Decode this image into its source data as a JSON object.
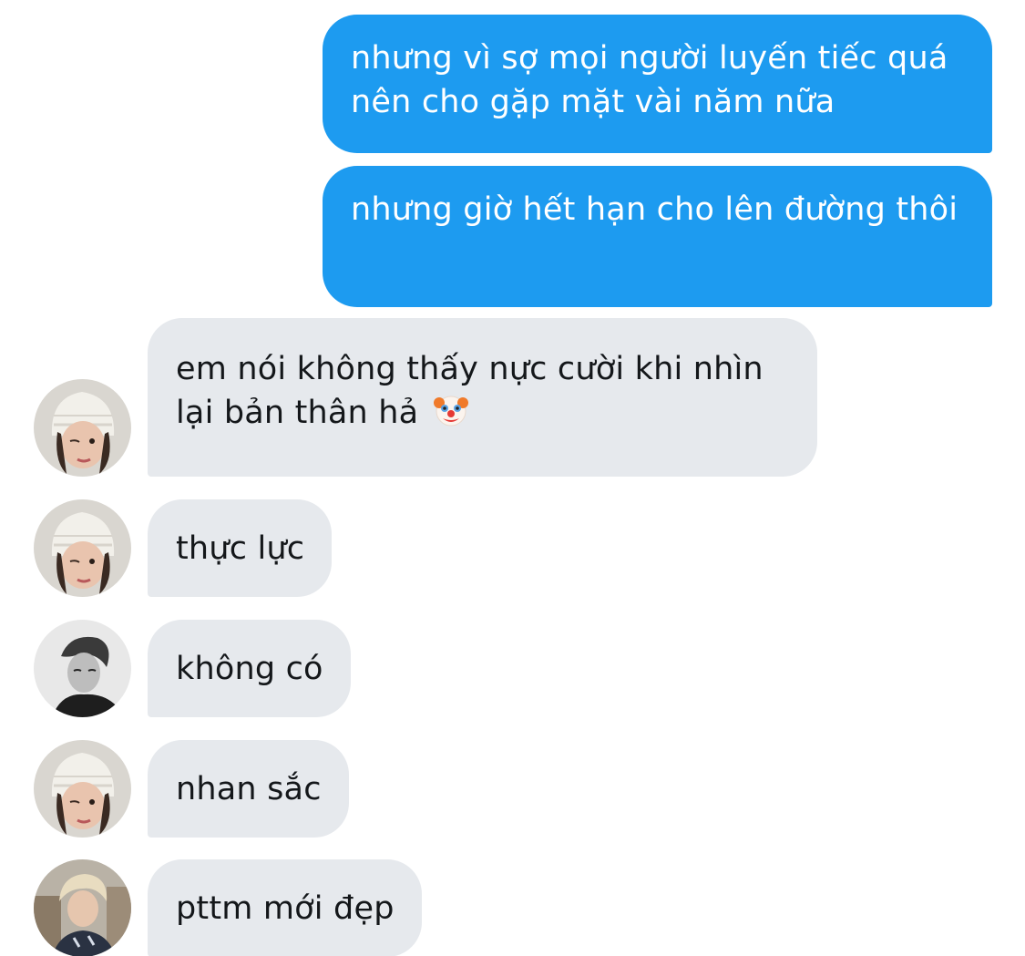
{
  "messages": [
    {
      "direction": "outgoing",
      "text": "nhưng vì sợ mọi người luyến tiếc quá nên cho gặp mặt vài năm nữa"
    },
    {
      "direction": "outgoing",
      "text": "nhưng giờ hết hạn cho lên đường thôi"
    },
    {
      "direction": "incoming",
      "text": "em nói không thấy nực cười khi nhìn lại bản thân hả",
      "emoji": "clown-face-icon",
      "avatar": "avatar-user-beanie"
    },
    {
      "direction": "incoming",
      "text": "thực lực",
      "avatar": "avatar-user-beanie"
    },
    {
      "direction": "incoming",
      "text": "không có",
      "avatar": "avatar-user-monochrome"
    },
    {
      "direction": "incoming",
      "text": "nhan sắc",
      "avatar": "avatar-user-beanie"
    },
    {
      "direction": "incoming",
      "text": "pttm mới đẹp",
      "avatar": "avatar-user-blonde"
    }
  ],
  "colors": {
    "outgoing_bubble": "#1d9bf0",
    "incoming_bubble": "#e6e9ed",
    "outgoing_text": "#ffffff",
    "incoming_text": "#14171a"
  }
}
